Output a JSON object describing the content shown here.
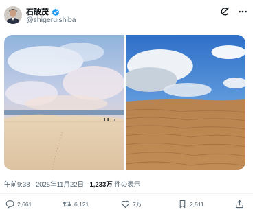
{
  "author": {
    "display_name": "石破茂",
    "handle": "@shigeruishiba",
    "avatar": "avatar-portrait",
    "verified_icon": "verified-badge-icon"
  },
  "header_icons": [
    "grok-icon",
    "more-options-icon"
  ],
  "media": {
    "photos": [
      {
        "name": "photo-dunes-clouds-sea"
      },
      {
        "name": "photo-dunes-ripples-sky"
      }
    ]
  },
  "meta": {
    "time": "午前9:38",
    "separator": " · ",
    "date": "2025年11月22日",
    "views_count": "1,233万",
    "views_label": " 件の表示"
  },
  "actions": {
    "reply": {
      "count": "2,661",
      "icon": "reply-icon"
    },
    "repost": {
      "count": "6,121",
      "icon": "repost-icon"
    },
    "like": {
      "count": "7万",
      "icon": "like-icon"
    },
    "bookmark": {
      "count": "2,511",
      "icon": "bookmark-icon"
    },
    "share": {
      "icon": "share-icon"
    }
  },
  "colors": {
    "text": "#0f1419",
    "secondary": "#536471",
    "verified": "#1d9bf0"
  }
}
